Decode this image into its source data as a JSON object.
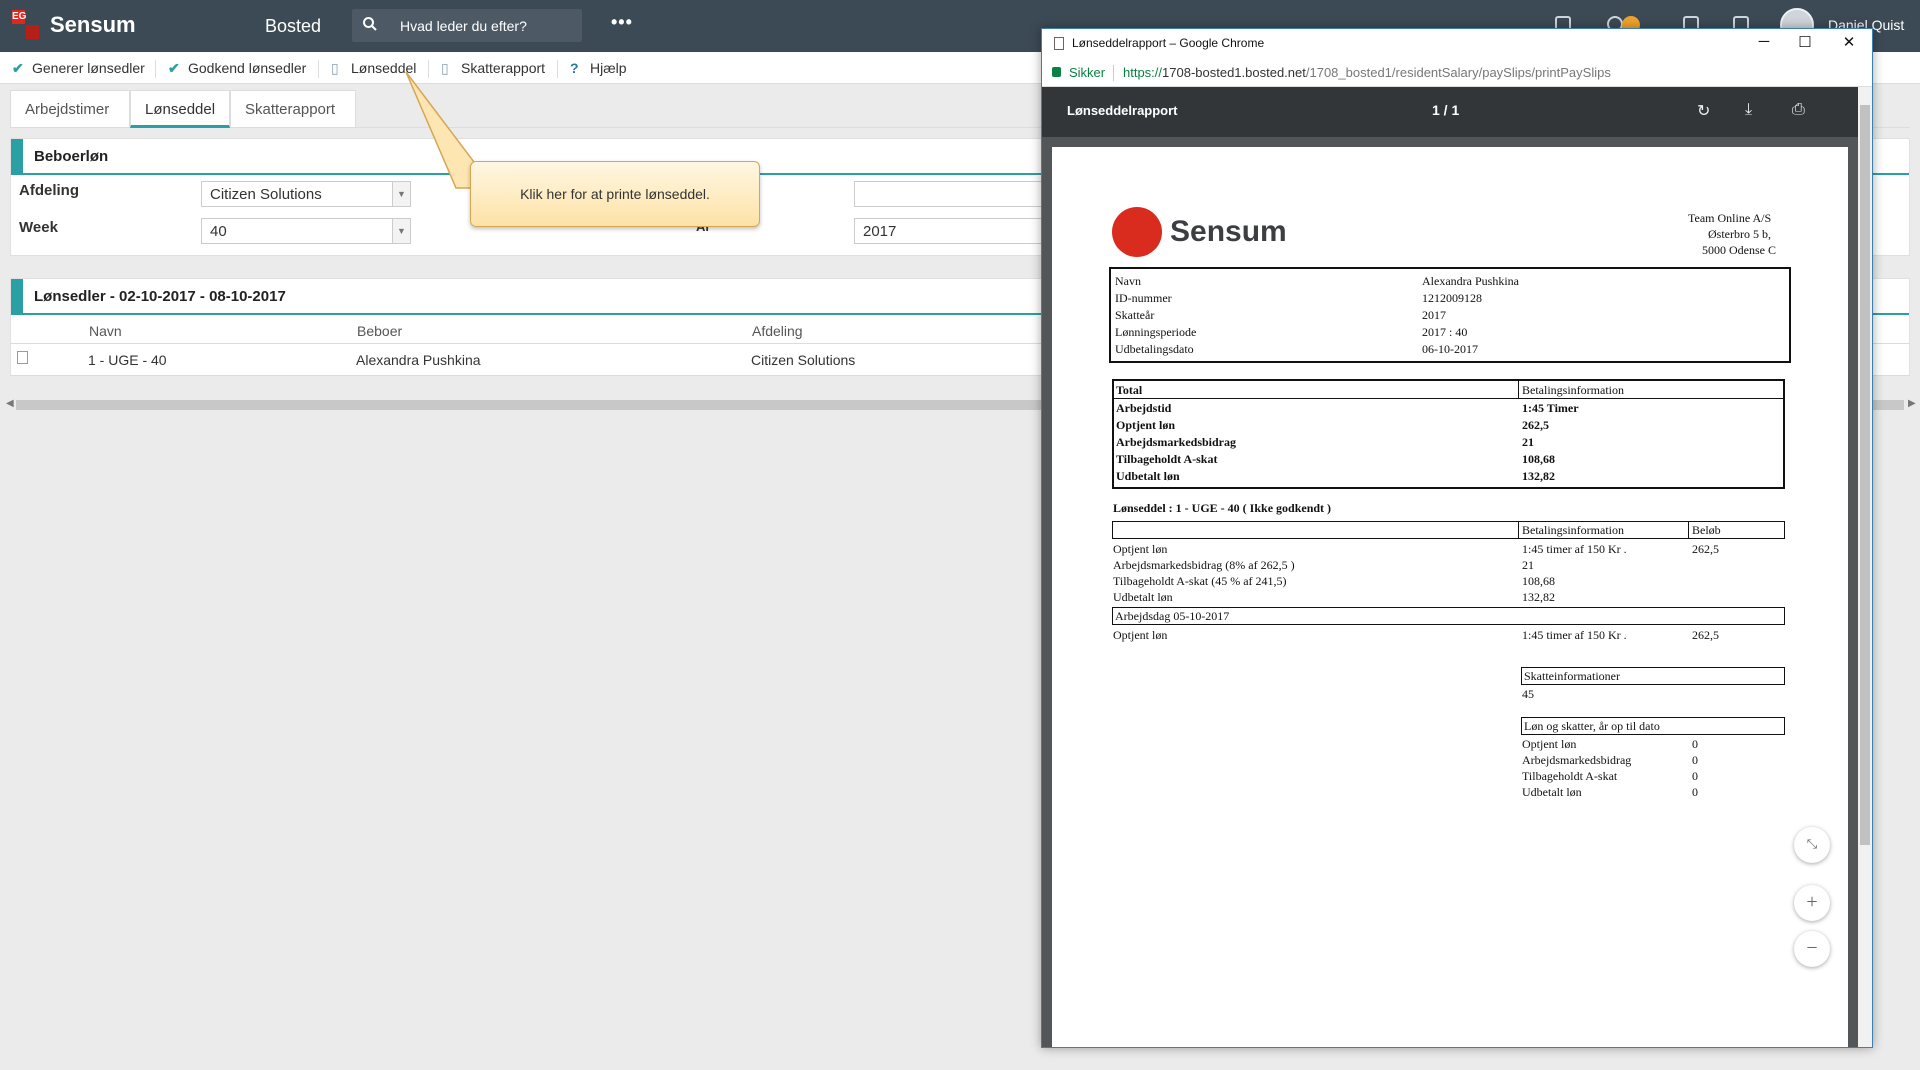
{
  "app": {
    "logo_mark": "EG",
    "name": "Sensum",
    "module": "Bosted",
    "search_placeholder": "Hvad leder du efter?",
    "more": "•••",
    "user": "Daniel Quist"
  },
  "toolbar": {
    "generate": "Generer lønsedler",
    "approve": "Godkend lønsedler",
    "payslip": "Lønseddel",
    "tax_report": "Skatterapport",
    "help": "Hjælp"
  },
  "tabs": [
    "Arbejdstimer",
    "Lønseddel",
    "Skatterapport"
  ],
  "filter_panel": {
    "title": "Beboerløn",
    "department_label": "Afdeling",
    "department_value": "Citizen Solutions",
    "week_label": "Week",
    "week_value": "40",
    "year_label": "År",
    "year_value": "2017"
  },
  "list_panel": {
    "title": "Lønsedler - 02-10-2017 - 08-10-2017",
    "columns": [
      "Navn",
      "Beboer",
      "Afdeling"
    ],
    "rows": [
      {
        "name": "1 - UGE - 40",
        "resident": "Alexandra Pushkina",
        "department": "Citizen Solutions"
      }
    ]
  },
  "callout": "Klik her for at printe lønseddel.",
  "chrome": {
    "window_title": "Lønseddelrapport – Google Chrome",
    "secure_label": "Sikker",
    "url_scheme": "https://",
    "url_host": "1708-bosted1.bosted.net",
    "url_path": "/1708_bosted1/residentSalary/paySlips/printPaySlips"
  },
  "pdf": {
    "title": "Lønseddelrapport",
    "page_indicator": "1  /  1",
    "company": [
      "Team Online A/S",
      "Østerbro 5 b,",
      "5000 Odense C"
    ],
    "logo_word": "Sensum",
    "info_labels": [
      "Navn",
      "ID-nummer",
      "Skatteår",
      "Lønningsperiode",
      "Udbetalingsdato"
    ],
    "info_values": [
      "Alexandra Pushkina",
      "1212009128",
      "2017",
      "2017 : 40",
      "06-10-2017"
    ],
    "total_header": "Total",
    "payment_info_header": "Betalingsinformation",
    "total_labels": [
      "Arbejdstid",
      "Optjent løn",
      "Arbejdsmarkedsbidrag",
      "Tilbageholdt A-skat",
      "Udbetalt løn"
    ],
    "total_values": [
      "1:45 Timer",
      "262,5",
      "21",
      "108,68",
      "132,82"
    ],
    "slip_title": "Lønseddel : 1 - UGE - 40 ( Ikke godkendt )",
    "amount_header": "Beløb",
    "slip_rows": [
      {
        "label": "Optjent løn",
        "info": "1:45 timer af 150 Kr .",
        "amount": "262,5"
      },
      {
        "label": "Arbejdsmarkedsbidrag (8% af 262,5 )",
        "info": "21",
        "amount": ""
      },
      {
        "label": "Tilbageholdt A-skat (45 % af 241,5)",
        "info": "108,68",
        "amount": ""
      },
      {
        "label": "Udbetalt løn",
        "info": "132,82",
        "amount": ""
      }
    ],
    "workday": "Arbejdsdag 05-10-2017",
    "workday_row": {
      "label": "Optjent løn",
      "info": "1:45 timer af 150 Kr .",
      "amount": "262,5"
    },
    "tax_info_header": "Skatteinformationer",
    "tax_info_value": "45",
    "ytd_header": "Løn og skatter, år op til dato",
    "ytd_rows": [
      {
        "label": "Optjent løn",
        "value": "0"
      },
      {
        "label": "Arbejdsmarkedsbidrag",
        "value": "0"
      },
      {
        "label": "Tilbageholdt A-skat",
        "value": "0"
      },
      {
        "label": "Udbetalt løn",
        "value": "0"
      }
    ]
  }
}
